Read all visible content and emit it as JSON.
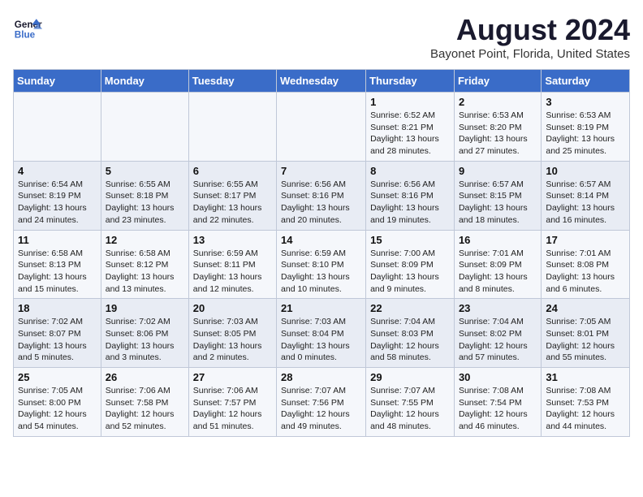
{
  "header": {
    "logo_line1": "General",
    "logo_line2": "Blue",
    "month_title": "August 2024",
    "location": "Bayonet Point, Florida, United States"
  },
  "weekdays": [
    "Sunday",
    "Monday",
    "Tuesday",
    "Wednesday",
    "Thursday",
    "Friday",
    "Saturday"
  ],
  "weeks": [
    [
      {
        "num": "",
        "detail": ""
      },
      {
        "num": "",
        "detail": ""
      },
      {
        "num": "",
        "detail": ""
      },
      {
        "num": "",
        "detail": ""
      },
      {
        "num": "1",
        "detail": "Sunrise: 6:52 AM\nSunset: 8:21 PM\nDaylight: 13 hours\nand 28 minutes."
      },
      {
        "num": "2",
        "detail": "Sunrise: 6:53 AM\nSunset: 8:20 PM\nDaylight: 13 hours\nand 27 minutes."
      },
      {
        "num": "3",
        "detail": "Sunrise: 6:53 AM\nSunset: 8:19 PM\nDaylight: 13 hours\nand 25 minutes."
      }
    ],
    [
      {
        "num": "4",
        "detail": "Sunrise: 6:54 AM\nSunset: 8:19 PM\nDaylight: 13 hours\nand 24 minutes."
      },
      {
        "num": "5",
        "detail": "Sunrise: 6:55 AM\nSunset: 8:18 PM\nDaylight: 13 hours\nand 23 minutes."
      },
      {
        "num": "6",
        "detail": "Sunrise: 6:55 AM\nSunset: 8:17 PM\nDaylight: 13 hours\nand 22 minutes."
      },
      {
        "num": "7",
        "detail": "Sunrise: 6:56 AM\nSunset: 8:16 PM\nDaylight: 13 hours\nand 20 minutes."
      },
      {
        "num": "8",
        "detail": "Sunrise: 6:56 AM\nSunset: 8:16 PM\nDaylight: 13 hours\nand 19 minutes."
      },
      {
        "num": "9",
        "detail": "Sunrise: 6:57 AM\nSunset: 8:15 PM\nDaylight: 13 hours\nand 18 minutes."
      },
      {
        "num": "10",
        "detail": "Sunrise: 6:57 AM\nSunset: 8:14 PM\nDaylight: 13 hours\nand 16 minutes."
      }
    ],
    [
      {
        "num": "11",
        "detail": "Sunrise: 6:58 AM\nSunset: 8:13 PM\nDaylight: 13 hours\nand 15 minutes."
      },
      {
        "num": "12",
        "detail": "Sunrise: 6:58 AM\nSunset: 8:12 PM\nDaylight: 13 hours\nand 13 minutes."
      },
      {
        "num": "13",
        "detail": "Sunrise: 6:59 AM\nSunset: 8:11 PM\nDaylight: 13 hours\nand 12 minutes."
      },
      {
        "num": "14",
        "detail": "Sunrise: 6:59 AM\nSunset: 8:10 PM\nDaylight: 13 hours\nand 10 minutes."
      },
      {
        "num": "15",
        "detail": "Sunrise: 7:00 AM\nSunset: 8:09 PM\nDaylight: 13 hours\nand 9 minutes."
      },
      {
        "num": "16",
        "detail": "Sunrise: 7:01 AM\nSunset: 8:09 PM\nDaylight: 13 hours\nand 8 minutes."
      },
      {
        "num": "17",
        "detail": "Sunrise: 7:01 AM\nSunset: 8:08 PM\nDaylight: 13 hours\nand 6 minutes."
      }
    ],
    [
      {
        "num": "18",
        "detail": "Sunrise: 7:02 AM\nSunset: 8:07 PM\nDaylight: 13 hours\nand 5 minutes."
      },
      {
        "num": "19",
        "detail": "Sunrise: 7:02 AM\nSunset: 8:06 PM\nDaylight: 13 hours\nand 3 minutes."
      },
      {
        "num": "20",
        "detail": "Sunrise: 7:03 AM\nSunset: 8:05 PM\nDaylight: 13 hours\nand 2 minutes."
      },
      {
        "num": "21",
        "detail": "Sunrise: 7:03 AM\nSunset: 8:04 PM\nDaylight: 13 hours\nand 0 minutes."
      },
      {
        "num": "22",
        "detail": "Sunrise: 7:04 AM\nSunset: 8:03 PM\nDaylight: 12 hours\nand 58 minutes."
      },
      {
        "num": "23",
        "detail": "Sunrise: 7:04 AM\nSunset: 8:02 PM\nDaylight: 12 hours\nand 57 minutes."
      },
      {
        "num": "24",
        "detail": "Sunrise: 7:05 AM\nSunset: 8:01 PM\nDaylight: 12 hours\nand 55 minutes."
      }
    ],
    [
      {
        "num": "25",
        "detail": "Sunrise: 7:05 AM\nSunset: 8:00 PM\nDaylight: 12 hours\nand 54 minutes."
      },
      {
        "num": "26",
        "detail": "Sunrise: 7:06 AM\nSunset: 7:58 PM\nDaylight: 12 hours\nand 52 minutes."
      },
      {
        "num": "27",
        "detail": "Sunrise: 7:06 AM\nSunset: 7:57 PM\nDaylight: 12 hours\nand 51 minutes."
      },
      {
        "num": "28",
        "detail": "Sunrise: 7:07 AM\nSunset: 7:56 PM\nDaylight: 12 hours\nand 49 minutes."
      },
      {
        "num": "29",
        "detail": "Sunrise: 7:07 AM\nSunset: 7:55 PM\nDaylight: 12 hours\nand 48 minutes."
      },
      {
        "num": "30",
        "detail": "Sunrise: 7:08 AM\nSunset: 7:54 PM\nDaylight: 12 hours\nand 46 minutes."
      },
      {
        "num": "31",
        "detail": "Sunrise: 7:08 AM\nSunset: 7:53 PM\nDaylight: 12 hours\nand 44 minutes."
      }
    ]
  ]
}
